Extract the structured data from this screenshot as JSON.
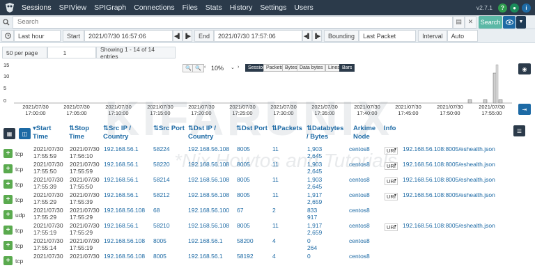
{
  "nav": {
    "items": [
      "Sessions",
      "SPIView",
      "SPIGraph",
      "Connections",
      "Files",
      "Stats",
      "History",
      "Settings",
      "Users"
    ],
    "version": "v2.7.1"
  },
  "search": {
    "placeholder": "Search",
    "button": "Search"
  },
  "time": {
    "range": "Last hour",
    "start_label": "Start",
    "start": "2021/07/30 16:57:06",
    "end_label": "End",
    "end": "2021/07/30 17:57:06",
    "bounding_label": "Bounding",
    "bounding": "Last Packet",
    "interval_label": "Interval",
    "interval": "Auto"
  },
  "paging": {
    "per_page": "50 per page",
    "page": "1",
    "summary": "Showing 1 - 14 of 14 entries"
  },
  "graph": {
    "zoom": "10%",
    "modes": [
      "Session",
      "Packets",
      "Bytes",
      "Data bytes"
    ],
    "styles": [
      "Lines",
      "Bars"
    ],
    "y_ticks": [
      "15",
      "10",
      "5",
      "0"
    ],
    "x_ticks": [
      [
        "2021/07/30",
        "17:00:00"
      ],
      [
        "2021/07/30",
        "17:05:00"
      ],
      [
        "2021/07/30",
        "17:10:00"
      ],
      [
        "2021/07/30",
        "17:15:00"
      ],
      [
        "2021/07/30",
        "17:20:00"
      ],
      [
        "2021/07/30",
        "17:25:00"
      ],
      [
        "2021/07/30",
        "17:30:00"
      ],
      [
        "2021/07/30",
        "17:35:00"
      ],
      [
        "2021/07/30",
        "17:40:00"
      ],
      [
        "2021/07/30",
        "17:45:00"
      ],
      [
        "2021/07/30",
        "17:50:00"
      ],
      [
        "2021/07/30",
        "17:55:00"
      ]
    ]
  },
  "table": {
    "headers": {
      "start": "Start Time",
      "stop": "Stop Time",
      "src_ip": "Src IP / Country",
      "src_port": "Src Port",
      "dst_ip": "Dst IP / Country",
      "dst_port": "Dst Port",
      "packets": "Packets",
      "databytes": "Databytes / Bytes",
      "node": "Arkime Node",
      "info": "Info"
    },
    "rows": [
      {
        "proto": "tcp",
        "start": [
          "2021/07/30",
          "17:55:59"
        ],
        "stop": [
          "2021/07/30",
          "17:56:10"
        ],
        "src": "192.168.56.1",
        "sport": "58224",
        "dst": "192.168.56.108",
        "dport": "8005",
        "pk": "11",
        "db": [
          "1,903",
          "2,645"
        ],
        "node": "centos8",
        "uri": "URI",
        "info": "192.168.56.108:8005/eshealth.json"
      },
      {
        "proto": "tcp",
        "start": [
          "2021/07/30",
          "17:55:50"
        ],
        "stop": [
          "2021/07/30",
          "17:55:59"
        ],
        "src": "192.168.56.1",
        "sport": "58220",
        "dst": "192.168.56.108",
        "dport": "8005",
        "pk": "11",
        "db": [
          "1,903",
          "2,645"
        ],
        "node": "centos8",
        "uri": "URI",
        "info": "192.168.56.108:8005/eshealth.json"
      },
      {
        "proto": "tcp",
        "start": [
          "2021/07/30",
          "17:55:39"
        ],
        "stop": [
          "2021/07/30",
          "17:55:50"
        ],
        "src": "192.168.56.1",
        "sport": "58214",
        "dst": "192.168.56.108",
        "dport": "8005",
        "pk": "11",
        "db": [
          "1,903",
          "2,645"
        ],
        "node": "centos8",
        "uri": "URI",
        "info": "192.168.56.108:8005/eshealth.json"
      },
      {
        "proto": "tcp",
        "start": [
          "2021/07/30",
          "17:55:29"
        ],
        "stop": [
          "2021/07/30",
          "17:55:39"
        ],
        "src": "192.168.56.1",
        "sport": "58212",
        "dst": "192.168.56.108",
        "dport": "8005",
        "pk": "11",
        "db": [
          "1,917",
          "2,659"
        ],
        "node": "centos8",
        "uri": "URI",
        "info": "192.168.56.108:8005/eshealth.json"
      },
      {
        "proto": "udp",
        "start": [
          "2021/07/30",
          "17:55:29"
        ],
        "stop": [
          "2021/07/30",
          "17:55:29"
        ],
        "src": "192.168.56.108",
        "sport": "68",
        "dst": "192.168.56.100",
        "dport": "67",
        "pk": "2",
        "db": [
          "833",
          "917"
        ],
        "node": "centos8",
        "uri": "",
        "info": ""
      },
      {
        "proto": "tcp",
        "start": [
          "2021/07/30",
          "17:55:19"
        ],
        "stop": [
          "2021/07/30",
          "17:55:29"
        ],
        "src": "192.168.56.1",
        "sport": "58210",
        "dst": "192.168.56.108",
        "dport": "8005",
        "pk": "11",
        "db": [
          "1,917",
          "2,659"
        ],
        "node": "centos8",
        "uri": "URI",
        "info": "192.168.56.108:8005/eshealth.json"
      },
      {
        "proto": "tcp",
        "start": [
          "2021/07/30",
          "17:55:14"
        ],
        "stop": [
          "2021/07/30",
          "17:55:19"
        ],
        "src": "192.168.56.108",
        "sport": "8005",
        "dst": "192.168.56.1",
        "dport": "58200",
        "pk": "4",
        "db": [
          "0",
          "264"
        ],
        "node": "centos8",
        "uri": "",
        "info": ""
      },
      {
        "proto": "tcp",
        "start": [
          "2021/07/30",
          ""
        ],
        "stop": [
          "2021/07/30",
          ""
        ],
        "src": "192.168.56.108",
        "sport": "8005",
        "dst": "192.168.56.1",
        "dport": "58192",
        "pk": "4",
        "db": [
          "0",
          ""
        ],
        "node": "centos8",
        "uri": "",
        "info": ""
      }
    ]
  },
  "watermark": {
    "brand": "KIFARUNIX",
    "tagline": "*Nix Howtos and Tutorials"
  },
  "colors": {
    "nav_bg": "#2b3a4a",
    "link": "#1d6aa5",
    "plus": "#5aaa4e",
    "search_btn": "#5bb8a6"
  }
}
